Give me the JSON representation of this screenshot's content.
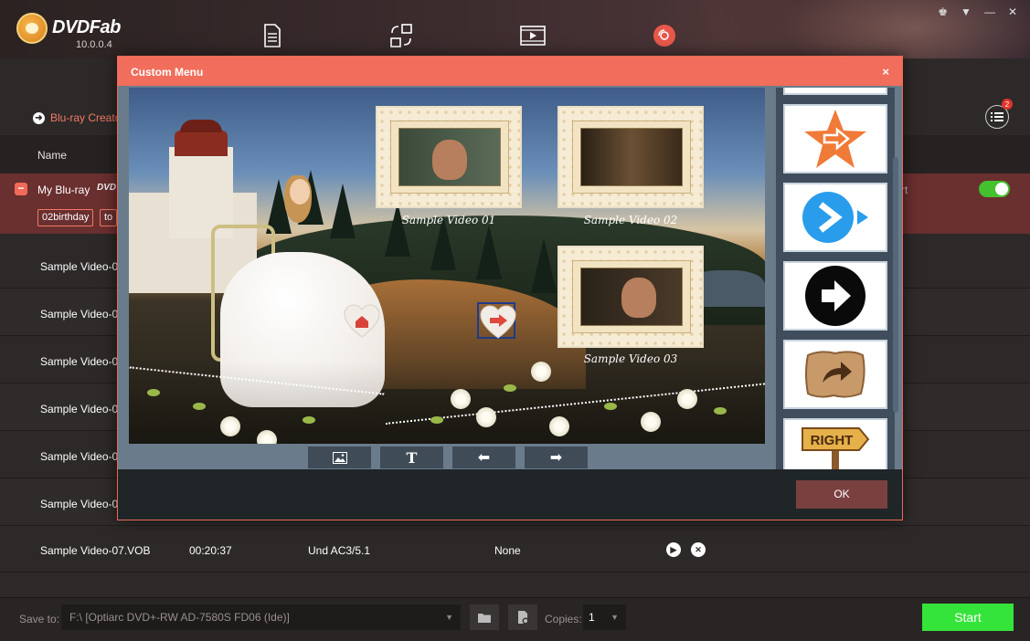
{
  "app": {
    "brand": "DVDFab",
    "version": "10.0.0.4"
  },
  "nav": {
    "copy_icon": "document-icon",
    "ripper_icon": "ripper-arrows-icon",
    "converter_icon": "video-play-icon",
    "creator_icon": "disc-icon"
  },
  "section": {
    "label": "Blu-ray Creator"
  },
  "queue": {
    "badge": "2"
  },
  "table": {
    "name_header": "Name"
  },
  "source": {
    "name": "My Blu-ray",
    "dvd_logo": "DVD",
    "tags": [
      "02birthday",
      "to"
    ],
    "right_text": "rt"
  },
  "files": [
    {
      "name": "Sample Video-0",
      "duration": "",
      "audio": "",
      "subtitle": ""
    },
    {
      "name": "Sample Video-0",
      "duration": "",
      "audio": "",
      "subtitle": ""
    },
    {
      "name": "Sample Video-0",
      "duration": "",
      "audio": "",
      "subtitle": ""
    },
    {
      "name": "Sample Video-0",
      "duration": "",
      "audio": "",
      "subtitle": ""
    },
    {
      "name": "Sample Video-0",
      "duration": "",
      "audio": "",
      "subtitle": ""
    },
    {
      "name": "Sample Video-0",
      "duration": "",
      "audio": "",
      "subtitle": ""
    },
    {
      "name": "Sample Video-07.VOB",
      "duration": "00:20:37",
      "audio": "Und  AC3/5.1",
      "subtitle": "None"
    }
  ],
  "bottom": {
    "save_label": "Save to:",
    "save_path": "F:\\ [Optiarc DVD+-RW AD-7580S FD06 (Ide)]",
    "copies_label": "Copies:",
    "copies_value": "1",
    "start_label": "Start"
  },
  "modal": {
    "title": "Custom Menu",
    "close": "×",
    "ok_label": "OK",
    "thumbs": [
      {
        "label": "Sample Video 01"
      },
      {
        "label": "Sample Video 02"
      },
      {
        "label": "Sample Video 03"
      }
    ],
    "templates": [
      {
        "icon": "pink-heart-icon"
      },
      {
        "icon": "orange-star-arrow-icon"
      },
      {
        "icon": "blue-circle-arrow-icon"
      },
      {
        "icon": "black-circle-arrow-icon"
      },
      {
        "icon": "parchment-arrow-icon"
      },
      {
        "icon": "right-signpost-icon",
        "text": "RIGHT"
      }
    ]
  },
  "colors": {
    "accent": "#f06e5b",
    "start_green": "#35e43a",
    "toggle_green": "#43c12f"
  }
}
